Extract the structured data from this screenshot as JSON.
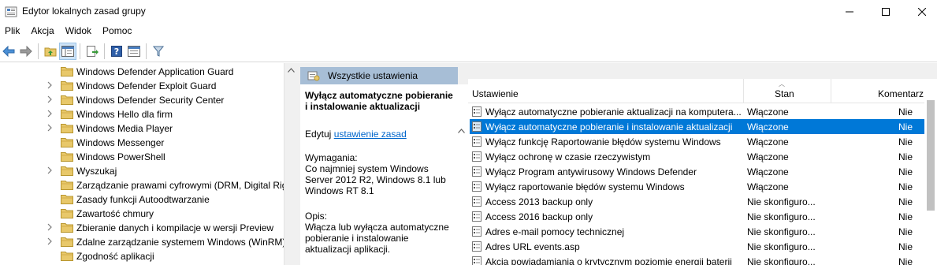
{
  "window": {
    "title": "Edytor lokalnych zasad grupy",
    "controls": {
      "minimize": "—",
      "maximize": "☐",
      "close": "✕"
    }
  },
  "menu": [
    "Plik",
    "Akcja",
    "Widok",
    "Pomoc"
  ],
  "toolbar": {
    "buttons": [
      "back-icon",
      "forward-icon",
      "up-folder-icon",
      "show-hide-tree-icon",
      "export-list-icon",
      "help-icon",
      "properties-icon",
      "filter-icon"
    ]
  },
  "tree": {
    "items": [
      {
        "label": "Windows Defender Application Guard",
        "expandable": false
      },
      {
        "label": "Windows Defender Exploit Guard",
        "expandable": true
      },
      {
        "label": "Windows Defender Security Center",
        "expandable": true
      },
      {
        "label": "Windows Hello dla firm",
        "expandable": true
      },
      {
        "label": "Windows Media Player",
        "expandable": true
      },
      {
        "label": "Windows Messenger",
        "expandable": false
      },
      {
        "label": "Windows PowerShell",
        "expandable": false
      },
      {
        "label": "Wyszukaj",
        "expandable": true
      },
      {
        "label": "Zarządzanie prawami cyfrowymi (DRM, Digital Rig",
        "expandable": false
      },
      {
        "label": "Zasady funkcji Autoodtwarzanie",
        "expandable": false
      },
      {
        "label": "Zawartość chmury",
        "expandable": false
      },
      {
        "label": "Zbieranie danych i kompilacje w wersji Preview",
        "expandable": true
      },
      {
        "label": "Zdalne zarządzanie systemem Windows (WinRM)",
        "expandable": true
      },
      {
        "label": "Zgodność aplikacji",
        "expandable": false
      }
    ]
  },
  "right_header": {
    "label": "Wszystkie ustawienia"
  },
  "description": {
    "title": "Wyłącz automatyczne pobieranie i instalowanie aktualizacji",
    "edit_prefix": "Edytuj",
    "edit_link": "ustawienie zasad",
    "requirements_label": "Wymagania:",
    "requirements_text": "Co najmniej system Windows Server 2012 R2, Windows 8.1 lub Windows RT 8.1",
    "opis_label": "Opis:",
    "opis_text": "Włącza lub wyłącza automatyczne pobieranie i instalowanie aktualizacji aplikacji."
  },
  "list": {
    "columns": {
      "name": "Ustawienie",
      "state": "Stan",
      "comment": "Komentarz"
    },
    "rows": [
      {
        "name": "Wyłącz automatyczne pobieranie aktualizacji na komputera...",
        "state": "Włączone",
        "comment": "Nie",
        "selected": false
      },
      {
        "name": "Wyłącz automatyczne pobieranie i instalowanie aktualizacji",
        "state": "Włączone",
        "comment": "Nie",
        "selected": true
      },
      {
        "name": "Wyłącz funkcję Raportowanie błędów systemu Windows",
        "state": "Włączone",
        "comment": "Nie",
        "selected": false
      },
      {
        "name": "Wyłącz ochronę w czasie rzeczywistym",
        "state": "Włączone",
        "comment": "Nie",
        "selected": false
      },
      {
        "name": "Wyłącz Program antywirusowy Windows Defender",
        "state": "Włączone",
        "comment": "Nie",
        "selected": false
      },
      {
        "name": "Wyłącz raportowanie błędów systemu Windows",
        "state": "Włączone",
        "comment": "Nie",
        "selected": false
      },
      {
        "name": "Access 2013 backup only",
        "state": "Nie skonfiguro...",
        "comment": "Nie",
        "selected": false
      },
      {
        "name": "Access 2016 backup only",
        "state": "Nie skonfiguro...",
        "comment": "Nie",
        "selected": false
      },
      {
        "name": "Adres e-mail pomocy technicznej",
        "state": "Nie skonfiguro...",
        "comment": "Nie",
        "selected": false
      },
      {
        "name": "Adres URL events.asp",
        "state": "Nie skonfiguro...",
        "comment": "Nie",
        "selected": false
      },
      {
        "name": "Akcja powiadamiania o krytycznym poziomie energii baterii",
        "state": "Nie skonfiguro...",
        "comment": "Nie",
        "selected": false
      }
    ]
  },
  "colors": {
    "selection": "#0078d7",
    "header_tab": "#a7bed6",
    "link": "#0066cc",
    "folder": "#e8c86a"
  }
}
